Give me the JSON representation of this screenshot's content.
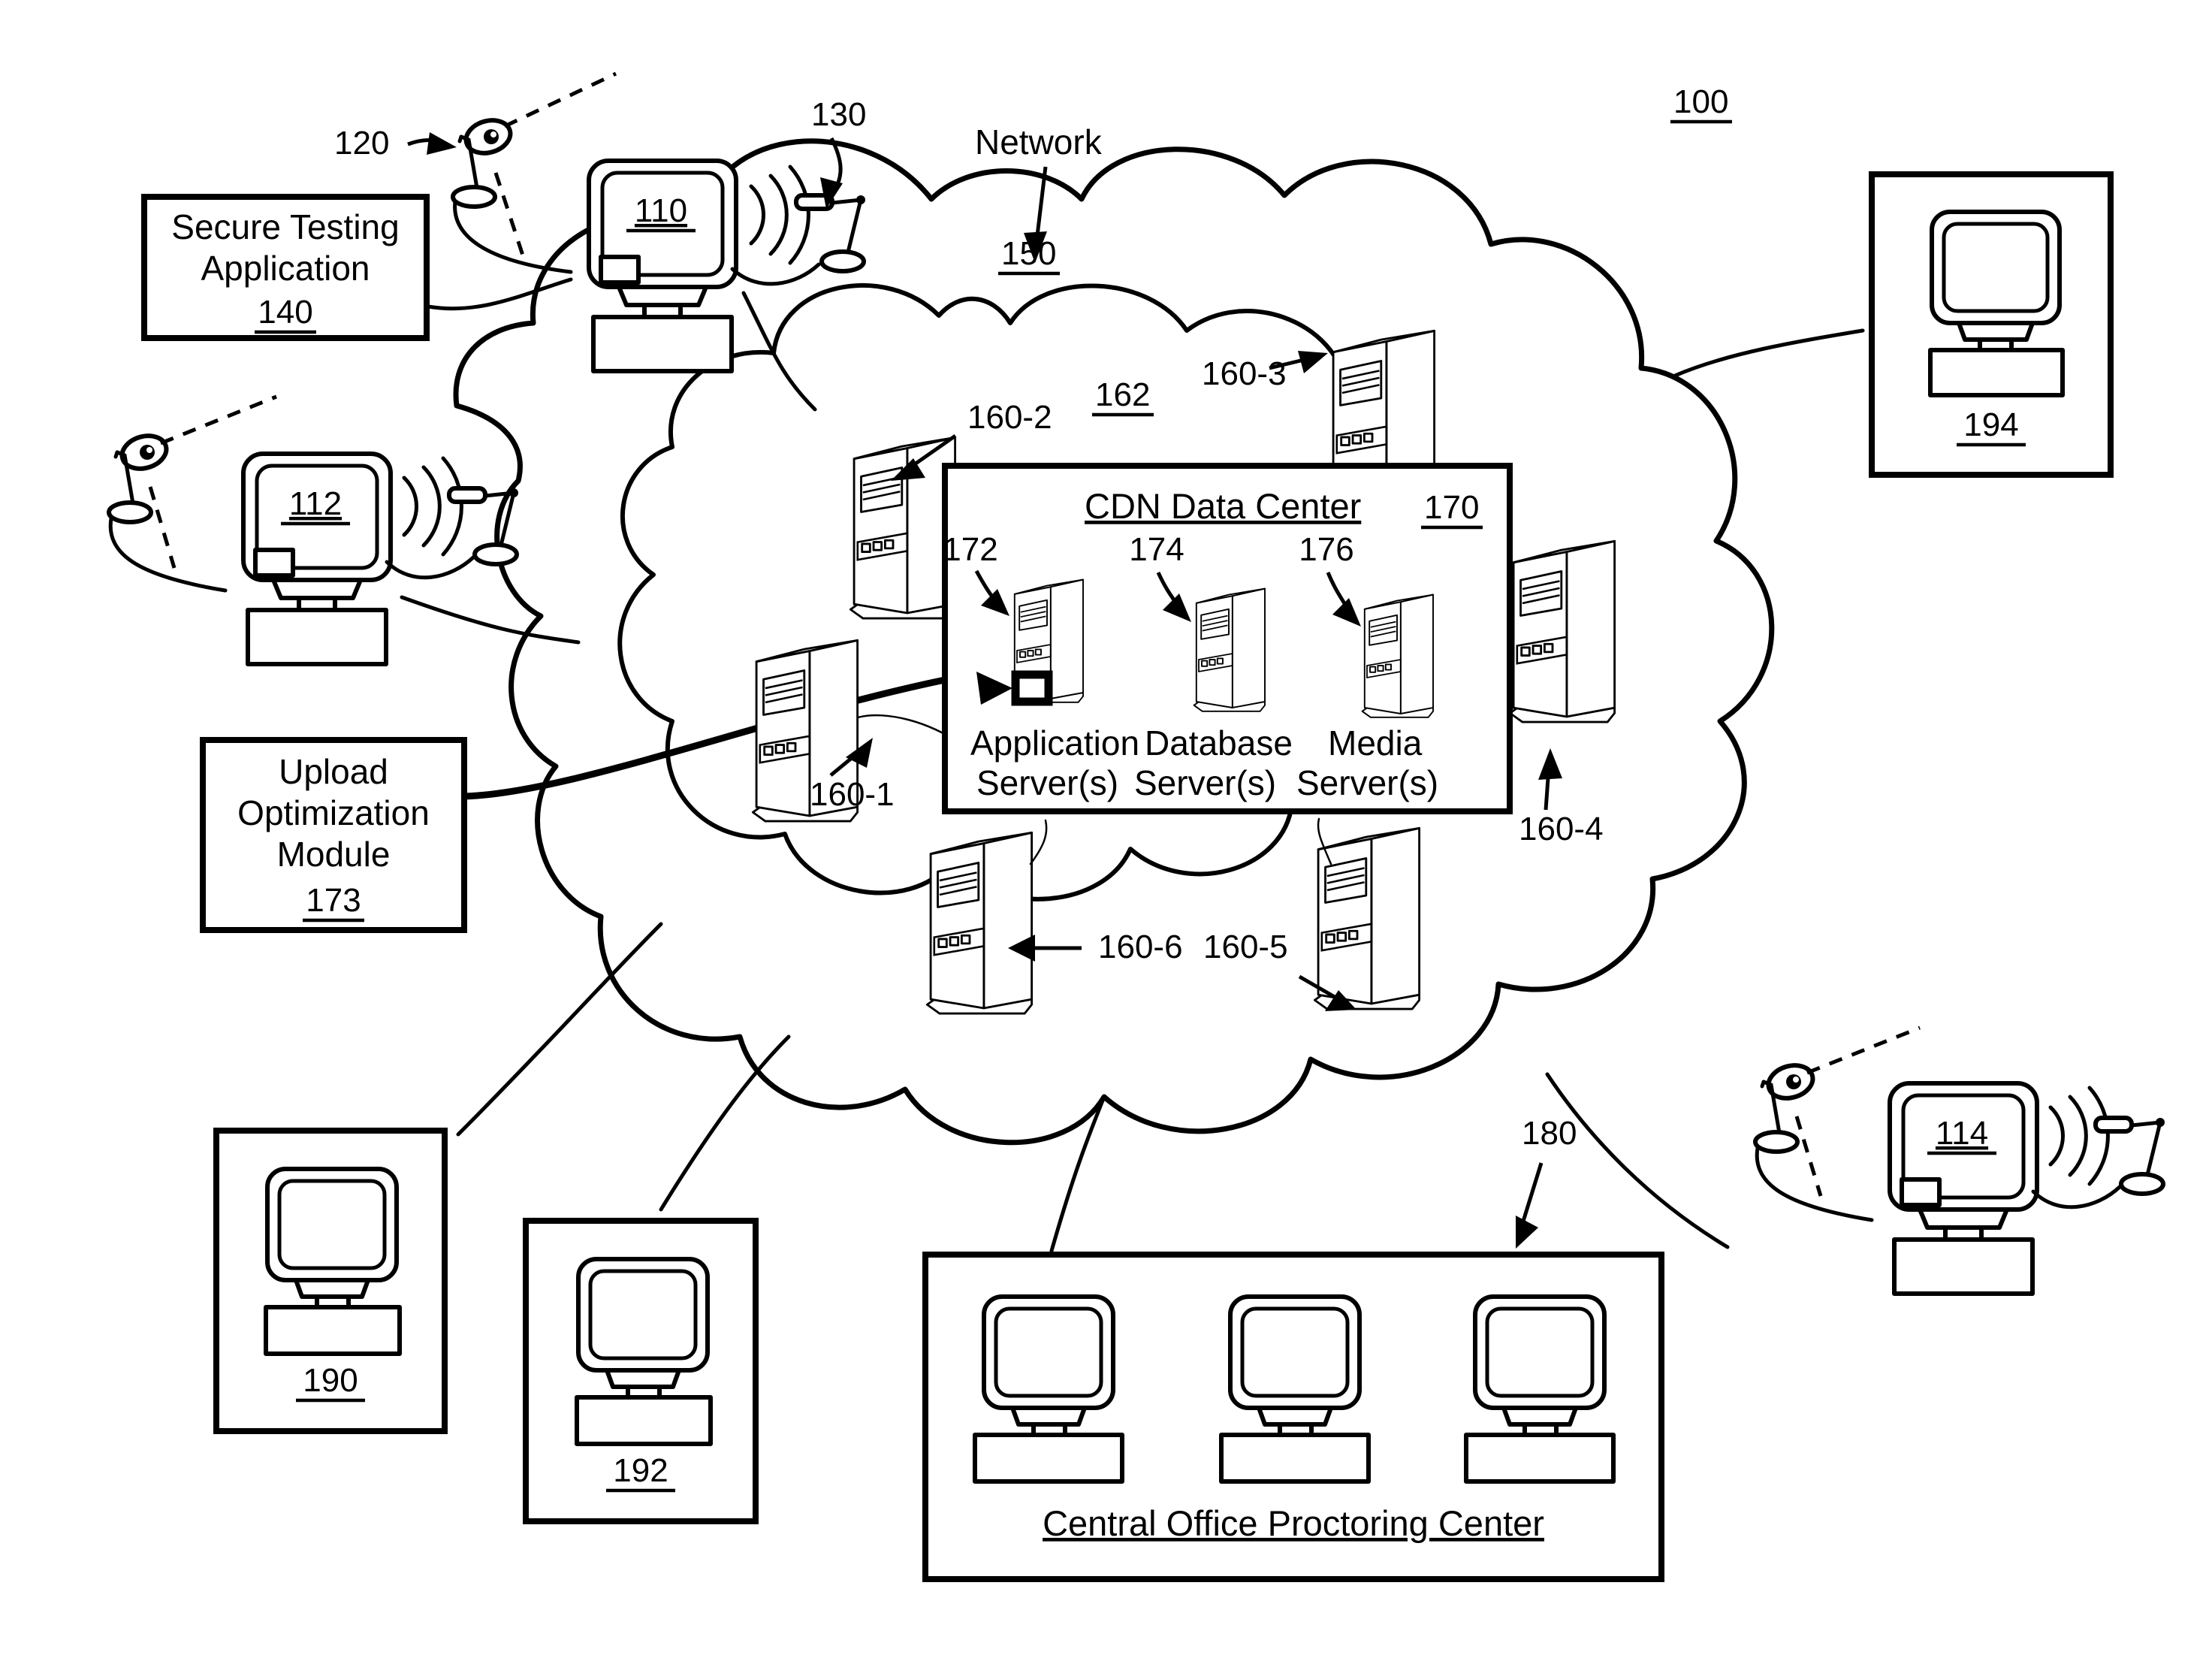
{
  "figure": {
    "system_ref": "100",
    "network_label": "Network",
    "network_ref": "150",
    "inner_cloud_ref": "162"
  },
  "boxes": {
    "secure_testing": {
      "line1": "Secure Testing",
      "line2": "Application",
      "ref": "140"
    },
    "upload_module": {
      "line1": "Upload",
      "line2": "Optimization",
      "line3": "Module",
      "ref": "173"
    },
    "cdn": {
      "title": "CDN Data Center",
      "ref": "170"
    },
    "proctoring": {
      "title": "Central Office Proctoring Center",
      "ref": "180"
    }
  },
  "workstations": [
    {
      "id": "ws-110",
      "screen_ref": "110",
      "camera_ref": "120",
      "mic_ref": "130"
    },
    {
      "id": "ws-112",
      "screen_ref": "112"
    },
    {
      "id": "ws-114",
      "screen_ref": "114"
    }
  ],
  "terminals": [
    {
      "id": "term-190",
      "ref": "190"
    },
    {
      "id": "term-192",
      "ref": "192"
    },
    {
      "id": "term-194",
      "ref": "194"
    }
  ],
  "cdn_servers": [
    {
      "ref": "172",
      "line1": "Application",
      "line2": "Server(s)"
    },
    {
      "ref": "174",
      "line1": "Database",
      "line2": "Server(s)"
    },
    {
      "ref": "176",
      "line1": "Media",
      "line2": "Server(s)"
    }
  ],
  "edge_servers": [
    {
      "ref": "160-1"
    },
    {
      "ref": "160-2"
    },
    {
      "ref": "160-3"
    },
    {
      "ref": "160-4"
    },
    {
      "ref": "160-5"
    },
    {
      "ref": "160-6"
    }
  ],
  "proctor_stations": 3,
  "colors": {
    "ink": "#000000",
    "paper": "#ffffff"
  }
}
